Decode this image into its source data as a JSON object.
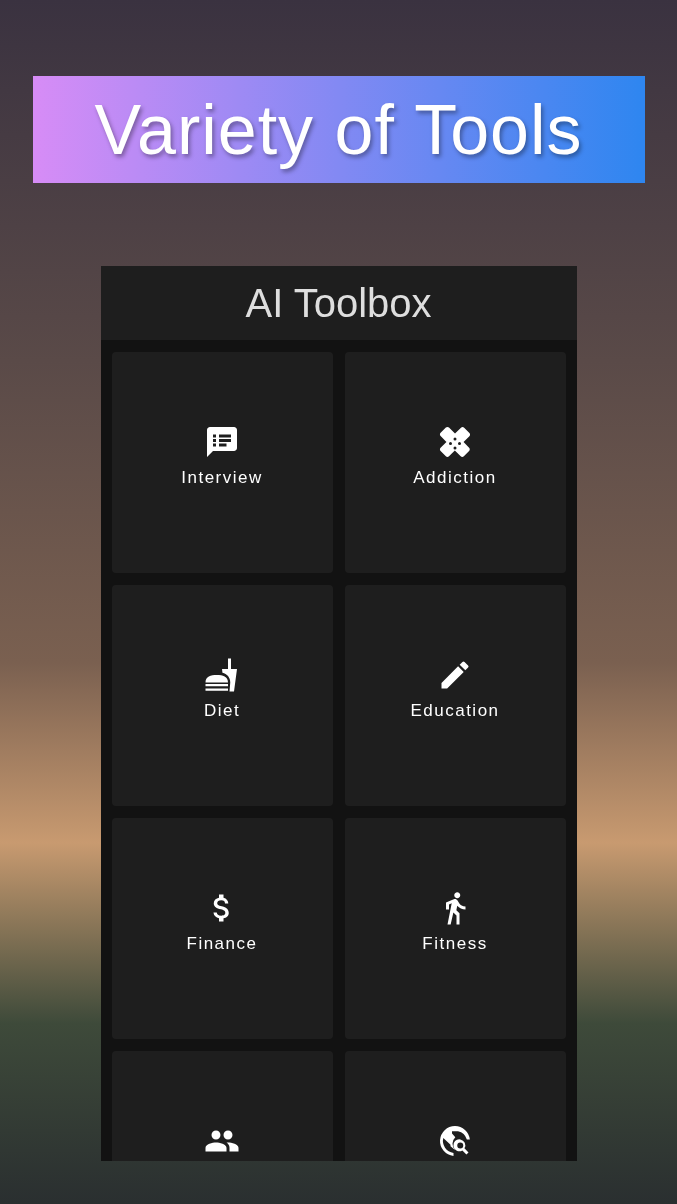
{
  "banner": {
    "title": "Variety of Tools"
  },
  "app": {
    "title": "AI Toolbox",
    "tools": [
      {
        "kind": "tool",
        "label": "Interview"
      },
      {
        "kind": "tool",
        "label": "Addiction"
      },
      {
        "kind": "tool",
        "label": "Diet"
      },
      {
        "kind": "tool",
        "label": "Education"
      },
      {
        "kind": "tool",
        "label": "Finance"
      },
      {
        "kind": "tool",
        "label": "Fitness"
      },
      {
        "kind": "cut_off"
      },
      {
        "kind": "cut_off"
      }
    ]
  }
}
